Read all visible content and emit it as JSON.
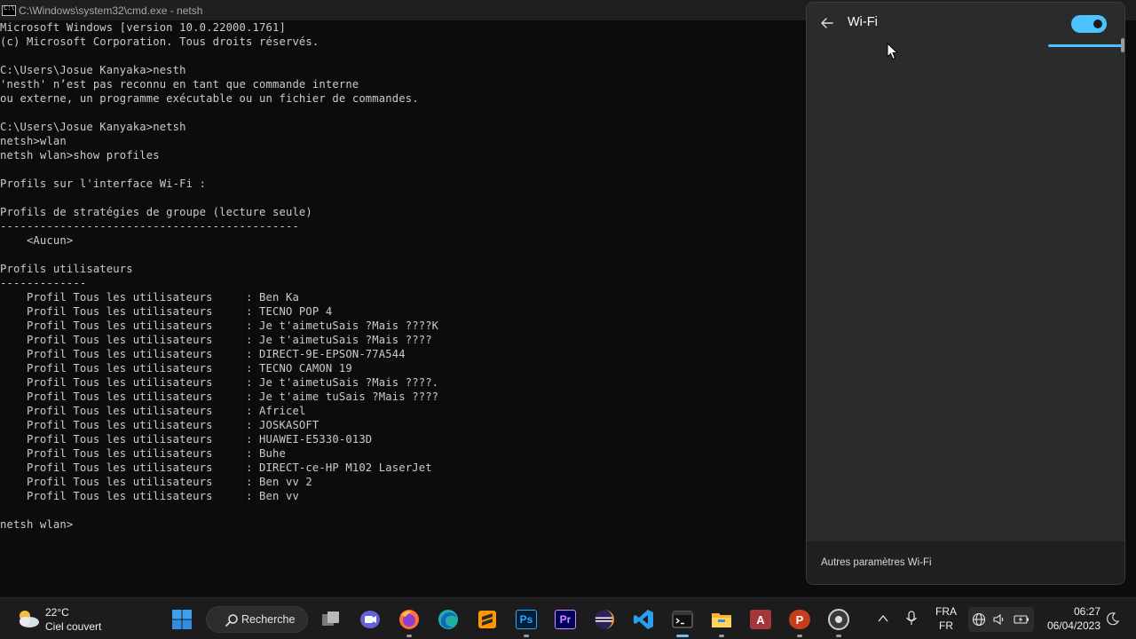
{
  "window": {
    "title": "C:\\Windows\\system32\\cmd.exe - netsh"
  },
  "console": {
    "lines": [
      "Microsoft Windows [version 10.0.22000.1761]",
      "(c) Microsoft Corporation. Tous droits réservés.",
      "",
      "C:\\Users\\Josue Kanyaka>nesth",
      "'nesth' n’est pas reconnu en tant que commande interne",
      "ou externe, un programme exécutable ou un fichier de commandes.",
      "",
      "C:\\Users\\Josue Kanyaka>netsh",
      "netsh>wlan",
      "netsh wlan>show profiles",
      "",
      "Profils sur l'interface Wi-Fi :",
      "",
      "Profils de stratégies de groupe (lecture seule)",
      "---------------------------------------------",
      "    <Aucun>",
      "",
      "Profils utilisateurs",
      "-------------",
      "    Profil Tous les utilisateurs     : Ben Ka",
      "    Profil Tous les utilisateurs     : TECNO POP 4",
      "    Profil Tous les utilisateurs     : Je t'aimetuSais ?Mais ????K",
      "    Profil Tous les utilisateurs     : Je t'aimetuSais ?Mais ????",
      "    Profil Tous les utilisateurs     : DIRECT-9E-EPSON-77A544",
      "    Profil Tous les utilisateurs     : TECNO CAMON 19",
      "    Profil Tous les utilisateurs     : Je t'aimetuSais ?Mais ????.",
      "    Profil Tous les utilisateurs     : Je t'aime tuSais ?Mais ????",
      "    Profil Tous les utilisateurs     : Africel",
      "    Profil Tous les utilisateurs     : JOSKASOFT",
      "    Profil Tous les utilisateurs     : HUAWEI-E5330-013D",
      "    Profil Tous les utilisateurs     : Buhe",
      "    Profil Tous les utilisateurs     : DIRECT-ce-HP M102 LaserJet",
      "    Profil Tous les utilisateurs     : Ben vv 2",
      "    Profil Tous les utilisateurs     : Ben vv",
      "",
      "netsh wlan>"
    ]
  },
  "wifi_panel": {
    "title": "Wi-Fi",
    "toggle_on": true,
    "more_settings": "Autres paramètres Wi-Fi"
  },
  "taskbar": {
    "weather": {
      "temp": "22°C",
      "desc": "Ciel couvert",
      "icon": "cloudy-sun-icon"
    },
    "search_label": "Recherche",
    "apps": [
      "start-icon",
      "task-view-icon",
      "teams-icon",
      "firefox-icon",
      "edge-icon",
      "sublime-text-icon",
      "photoshop-icon",
      "premiere-pro-icon",
      "eclipse-icon",
      "vscode-icon",
      "terminal-icon",
      "file-explorer-icon",
      "access-icon",
      "powerpoint-icon",
      "media-player-icon"
    ],
    "app_labels": {
      "photoshop": "Ps",
      "premiere": "Pr",
      "access": "A",
      "powerpoint": "P"
    },
    "language": {
      "lang": "FRA",
      "layout": "FR"
    },
    "clock": {
      "time": "06:27",
      "date": "06/04/2023"
    }
  },
  "colors": {
    "console_bg": "#0c0c0c",
    "console_fg": "#cccccc",
    "accent": "#4cc2ff",
    "panel_bg": "#2b2b2b",
    "taskbar_bg": "#1c1c1c"
  }
}
